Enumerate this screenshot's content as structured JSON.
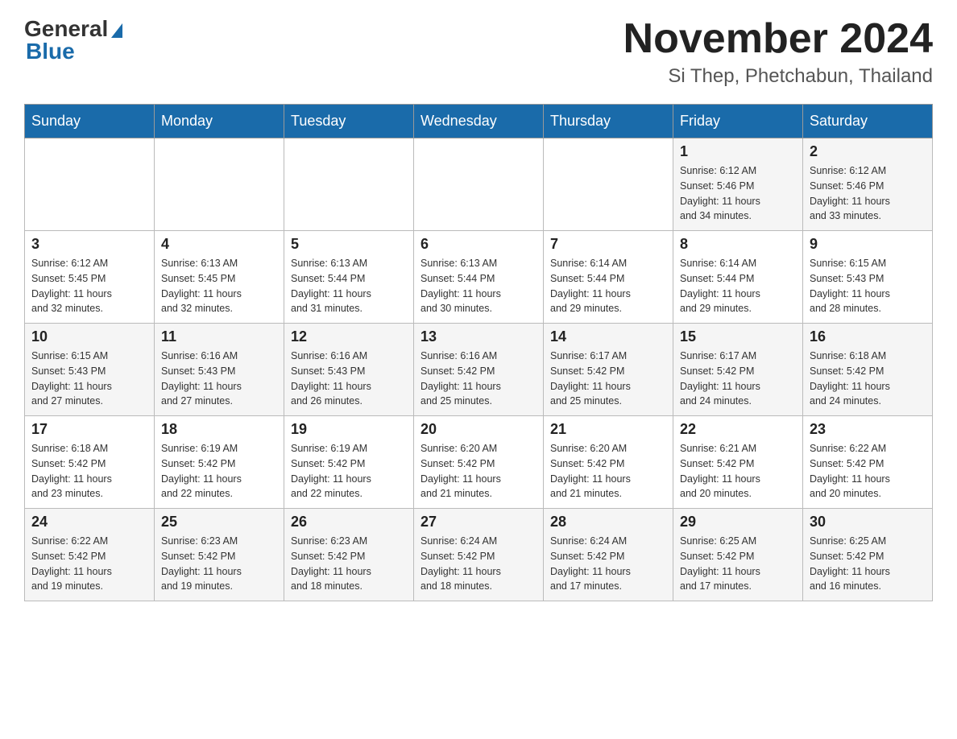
{
  "logo": {
    "general": "General",
    "blue": "Blue"
  },
  "title": {
    "month": "November 2024",
    "location": "Si Thep, Phetchabun, Thailand"
  },
  "weekdays": [
    "Sunday",
    "Monday",
    "Tuesday",
    "Wednesday",
    "Thursday",
    "Friday",
    "Saturday"
  ],
  "weeks": [
    [
      {
        "day": "",
        "info": ""
      },
      {
        "day": "",
        "info": ""
      },
      {
        "day": "",
        "info": ""
      },
      {
        "day": "",
        "info": ""
      },
      {
        "day": "",
        "info": ""
      },
      {
        "day": "1",
        "info": "Sunrise: 6:12 AM\nSunset: 5:46 PM\nDaylight: 11 hours\nand 34 minutes."
      },
      {
        "day": "2",
        "info": "Sunrise: 6:12 AM\nSunset: 5:46 PM\nDaylight: 11 hours\nand 33 minutes."
      }
    ],
    [
      {
        "day": "3",
        "info": "Sunrise: 6:12 AM\nSunset: 5:45 PM\nDaylight: 11 hours\nand 32 minutes."
      },
      {
        "day": "4",
        "info": "Sunrise: 6:13 AM\nSunset: 5:45 PM\nDaylight: 11 hours\nand 32 minutes."
      },
      {
        "day": "5",
        "info": "Sunrise: 6:13 AM\nSunset: 5:44 PM\nDaylight: 11 hours\nand 31 minutes."
      },
      {
        "day": "6",
        "info": "Sunrise: 6:13 AM\nSunset: 5:44 PM\nDaylight: 11 hours\nand 30 minutes."
      },
      {
        "day": "7",
        "info": "Sunrise: 6:14 AM\nSunset: 5:44 PM\nDaylight: 11 hours\nand 29 minutes."
      },
      {
        "day": "8",
        "info": "Sunrise: 6:14 AM\nSunset: 5:44 PM\nDaylight: 11 hours\nand 29 minutes."
      },
      {
        "day": "9",
        "info": "Sunrise: 6:15 AM\nSunset: 5:43 PM\nDaylight: 11 hours\nand 28 minutes."
      }
    ],
    [
      {
        "day": "10",
        "info": "Sunrise: 6:15 AM\nSunset: 5:43 PM\nDaylight: 11 hours\nand 27 minutes."
      },
      {
        "day": "11",
        "info": "Sunrise: 6:16 AM\nSunset: 5:43 PM\nDaylight: 11 hours\nand 27 minutes."
      },
      {
        "day": "12",
        "info": "Sunrise: 6:16 AM\nSunset: 5:43 PM\nDaylight: 11 hours\nand 26 minutes."
      },
      {
        "day": "13",
        "info": "Sunrise: 6:16 AM\nSunset: 5:42 PM\nDaylight: 11 hours\nand 25 minutes."
      },
      {
        "day": "14",
        "info": "Sunrise: 6:17 AM\nSunset: 5:42 PM\nDaylight: 11 hours\nand 25 minutes."
      },
      {
        "day": "15",
        "info": "Sunrise: 6:17 AM\nSunset: 5:42 PM\nDaylight: 11 hours\nand 24 minutes."
      },
      {
        "day": "16",
        "info": "Sunrise: 6:18 AM\nSunset: 5:42 PM\nDaylight: 11 hours\nand 24 minutes."
      }
    ],
    [
      {
        "day": "17",
        "info": "Sunrise: 6:18 AM\nSunset: 5:42 PM\nDaylight: 11 hours\nand 23 minutes."
      },
      {
        "day": "18",
        "info": "Sunrise: 6:19 AM\nSunset: 5:42 PM\nDaylight: 11 hours\nand 22 minutes."
      },
      {
        "day": "19",
        "info": "Sunrise: 6:19 AM\nSunset: 5:42 PM\nDaylight: 11 hours\nand 22 minutes."
      },
      {
        "day": "20",
        "info": "Sunrise: 6:20 AM\nSunset: 5:42 PM\nDaylight: 11 hours\nand 21 minutes."
      },
      {
        "day": "21",
        "info": "Sunrise: 6:20 AM\nSunset: 5:42 PM\nDaylight: 11 hours\nand 21 minutes."
      },
      {
        "day": "22",
        "info": "Sunrise: 6:21 AM\nSunset: 5:42 PM\nDaylight: 11 hours\nand 20 minutes."
      },
      {
        "day": "23",
        "info": "Sunrise: 6:22 AM\nSunset: 5:42 PM\nDaylight: 11 hours\nand 20 minutes."
      }
    ],
    [
      {
        "day": "24",
        "info": "Sunrise: 6:22 AM\nSunset: 5:42 PM\nDaylight: 11 hours\nand 19 minutes."
      },
      {
        "day": "25",
        "info": "Sunrise: 6:23 AM\nSunset: 5:42 PM\nDaylight: 11 hours\nand 19 minutes."
      },
      {
        "day": "26",
        "info": "Sunrise: 6:23 AM\nSunset: 5:42 PM\nDaylight: 11 hours\nand 18 minutes."
      },
      {
        "day": "27",
        "info": "Sunrise: 6:24 AM\nSunset: 5:42 PM\nDaylight: 11 hours\nand 18 minutes."
      },
      {
        "day": "28",
        "info": "Sunrise: 6:24 AM\nSunset: 5:42 PM\nDaylight: 11 hours\nand 17 minutes."
      },
      {
        "day": "29",
        "info": "Sunrise: 6:25 AM\nSunset: 5:42 PM\nDaylight: 11 hours\nand 17 minutes."
      },
      {
        "day": "30",
        "info": "Sunrise: 6:25 AM\nSunset: 5:42 PM\nDaylight: 11 hours\nand 16 minutes."
      }
    ]
  ]
}
